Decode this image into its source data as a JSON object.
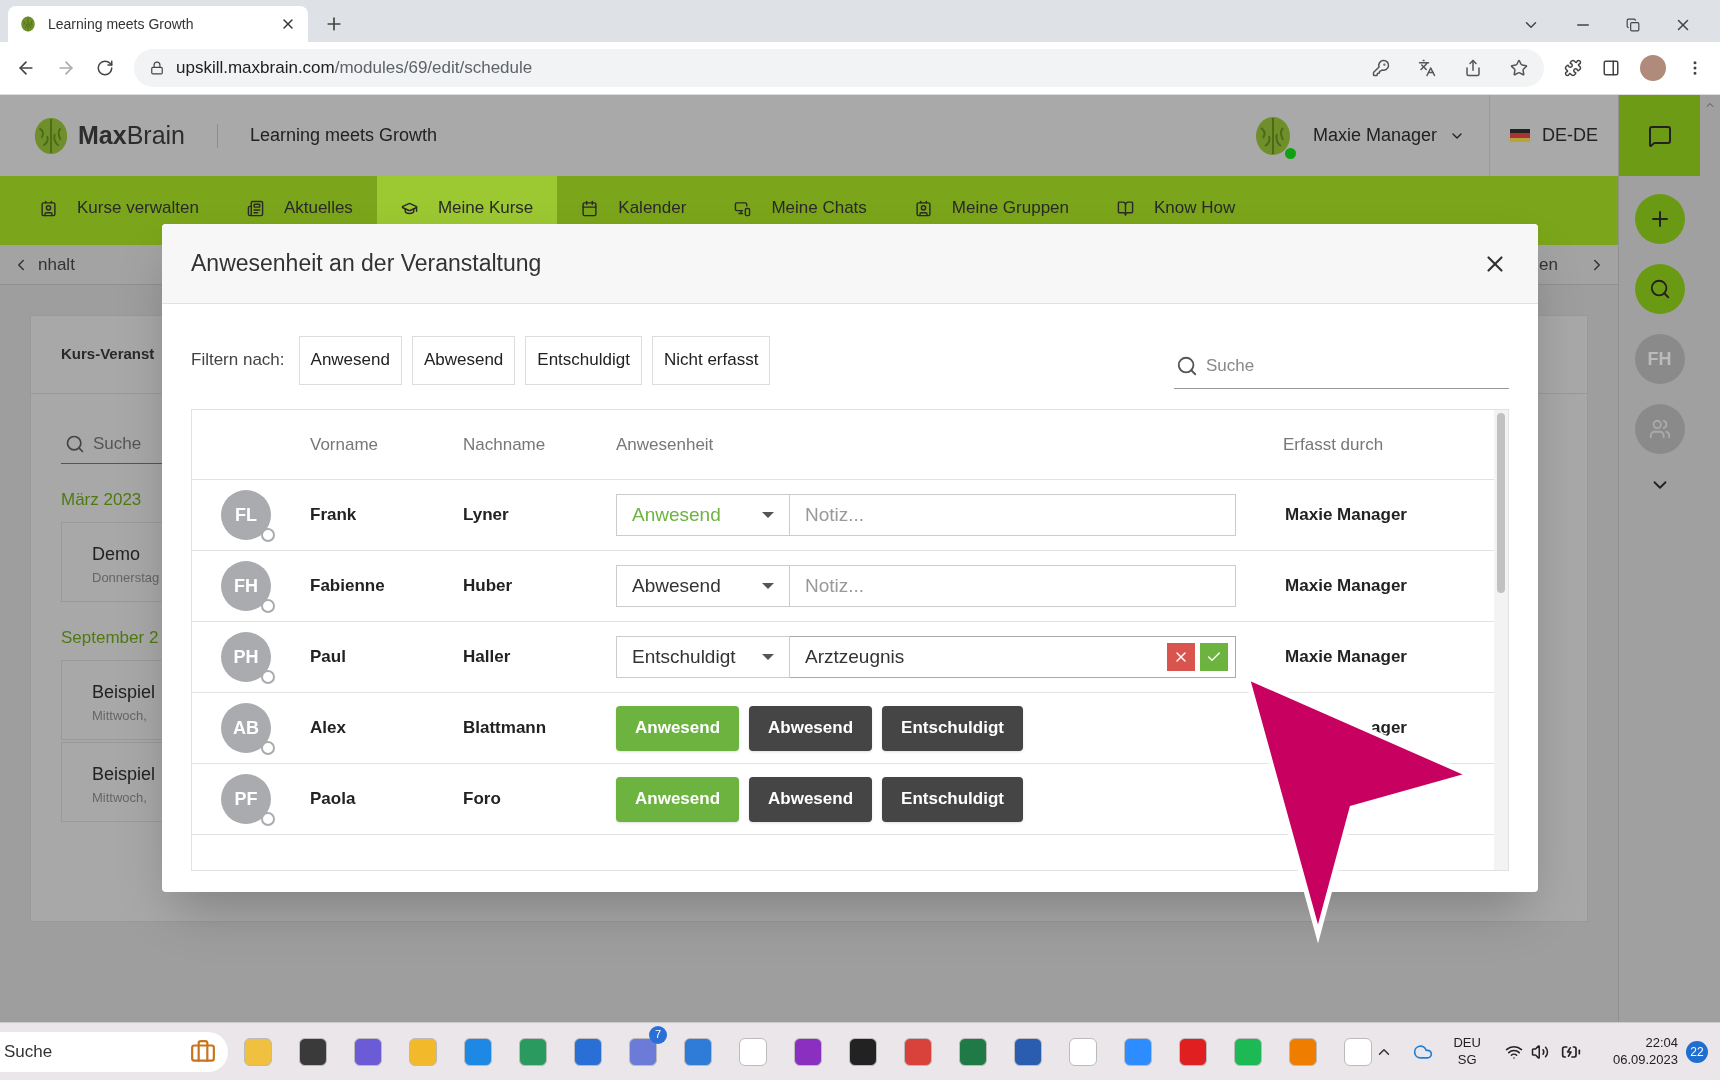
{
  "browser": {
    "tab_title": "Learning meets Growth",
    "url_host": "upskill.maxbrain.com",
    "url_path": "/modules/69/edit/schedule"
  },
  "header": {
    "logo_bold": "Max",
    "logo_light": "Brain",
    "tagline": "Learning meets Growth",
    "user": "Maxie Manager",
    "language": "DE-DE"
  },
  "nav": [
    {
      "label": "Kurse verwalten",
      "selected": false
    },
    {
      "label": "Aktuelles",
      "selected": false
    },
    {
      "label": "Meine Kurse",
      "selected": true
    },
    {
      "label": "Kalender",
      "selected": false
    },
    {
      "label": "Meine Chats",
      "selected": false
    },
    {
      "label": "Meine Gruppen",
      "selected": false
    },
    {
      "label": "Know How",
      "selected": false
    }
  ],
  "background": {
    "tab_left": "nhalt",
    "tab_right": "en",
    "panel_title": "Kurs-Veranst",
    "search_placeholder": "Suche",
    "groups": [
      {
        "month": "März 2023",
        "events": [
          {
            "title": "Demo",
            "subtitle": "Donnerstag"
          }
        ]
      },
      {
        "month": "September 2",
        "events": [
          {
            "title": "Beispiel",
            "subtitle": "Mittwoch, "
          },
          {
            "title": "Beispiel ",
            "subtitle": "Mittwoch, "
          }
        ]
      }
    ]
  },
  "sidebar": {
    "avatar": "FH"
  },
  "modal": {
    "title": "Anwesenheit an der Veranstaltung",
    "filter_label": "Filtern nach:",
    "filters": [
      "Anwesend",
      "Abwesend",
      "Entschuldigt",
      "Nicht erfasst"
    ],
    "search_placeholder": "Suche",
    "columns": [
      "Vorname",
      "Nachname",
      "Anwesenheit",
      "Erfasst durch"
    ],
    "rows": [
      {
        "initials": "FL",
        "first": "Frank",
        "last": "Lyner",
        "kind": "select",
        "value": "Anwesend",
        "color": "#6db33f",
        "note_placeholder": "Notiz...",
        "recorded_by": "Maxie Manager"
      },
      {
        "initials": "FH",
        "first": "Fabienne",
        "last": "Huber",
        "kind": "select",
        "value": "Abwesend",
        "color": "#333333",
        "note_placeholder": "Notiz...",
        "recorded_by": "Maxie Manager"
      },
      {
        "initials": "PH",
        "first": "Paul",
        "last": "Haller",
        "kind": "select",
        "value": "Entschuldigt",
        "color": "#333333",
        "note": "Arztzeugnis",
        "editing": true,
        "recorded_by": "Maxie Manager"
      },
      {
        "initials": "AB",
        "first": "Alex",
        "last": "Blattmann",
        "kind": "buttons",
        "options": [
          {
            "label": "Anwesend",
            "color": "#6db33f"
          },
          {
            "label": "Abwesend",
            "color": "#454545"
          },
          {
            "label": "Entschuldigt",
            "color": "#454545"
          }
        ],
        "recorded_by": "ager"
      },
      {
        "initials": "PF",
        "first": "Paola",
        "last": "Foro",
        "kind": "buttons",
        "options": [
          {
            "label": "Anwesend",
            "color": "#6db33f"
          },
          {
            "label": "Abwesend",
            "color": "#454545"
          },
          {
            "label": "Entschuldigt",
            "color": "#454545"
          }
        ]
      }
    ]
  },
  "taskbar": {
    "search": "Suche",
    "badge": "7",
    "lang": "DEU",
    "region": "SG",
    "time": "22:04",
    "date": "06.09.2023",
    "notifications": "22"
  }
}
